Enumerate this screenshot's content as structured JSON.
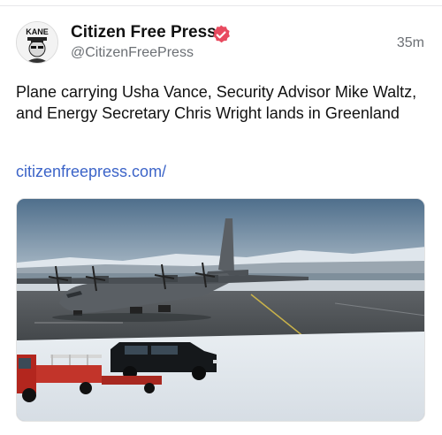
{
  "post": {
    "author_name": "Citizen Free Press",
    "handle": "@CitizenFreePress",
    "timestamp": "35m",
    "text": "Plane carrying Usha Vance, Security Advisor Mike Waltz, and Energy Secretary Chris Wright lands in Greenland",
    "link": "citizenfreepress.com/",
    "avatar_text": "KANE"
  },
  "colors": {
    "verified_badge": "#e84a5f",
    "link": "#3c64c8",
    "secondary_text": "#6b6f74"
  },
  "icons": {
    "verified": "verified-badge-icon",
    "avatar": "kane-avatar"
  }
}
